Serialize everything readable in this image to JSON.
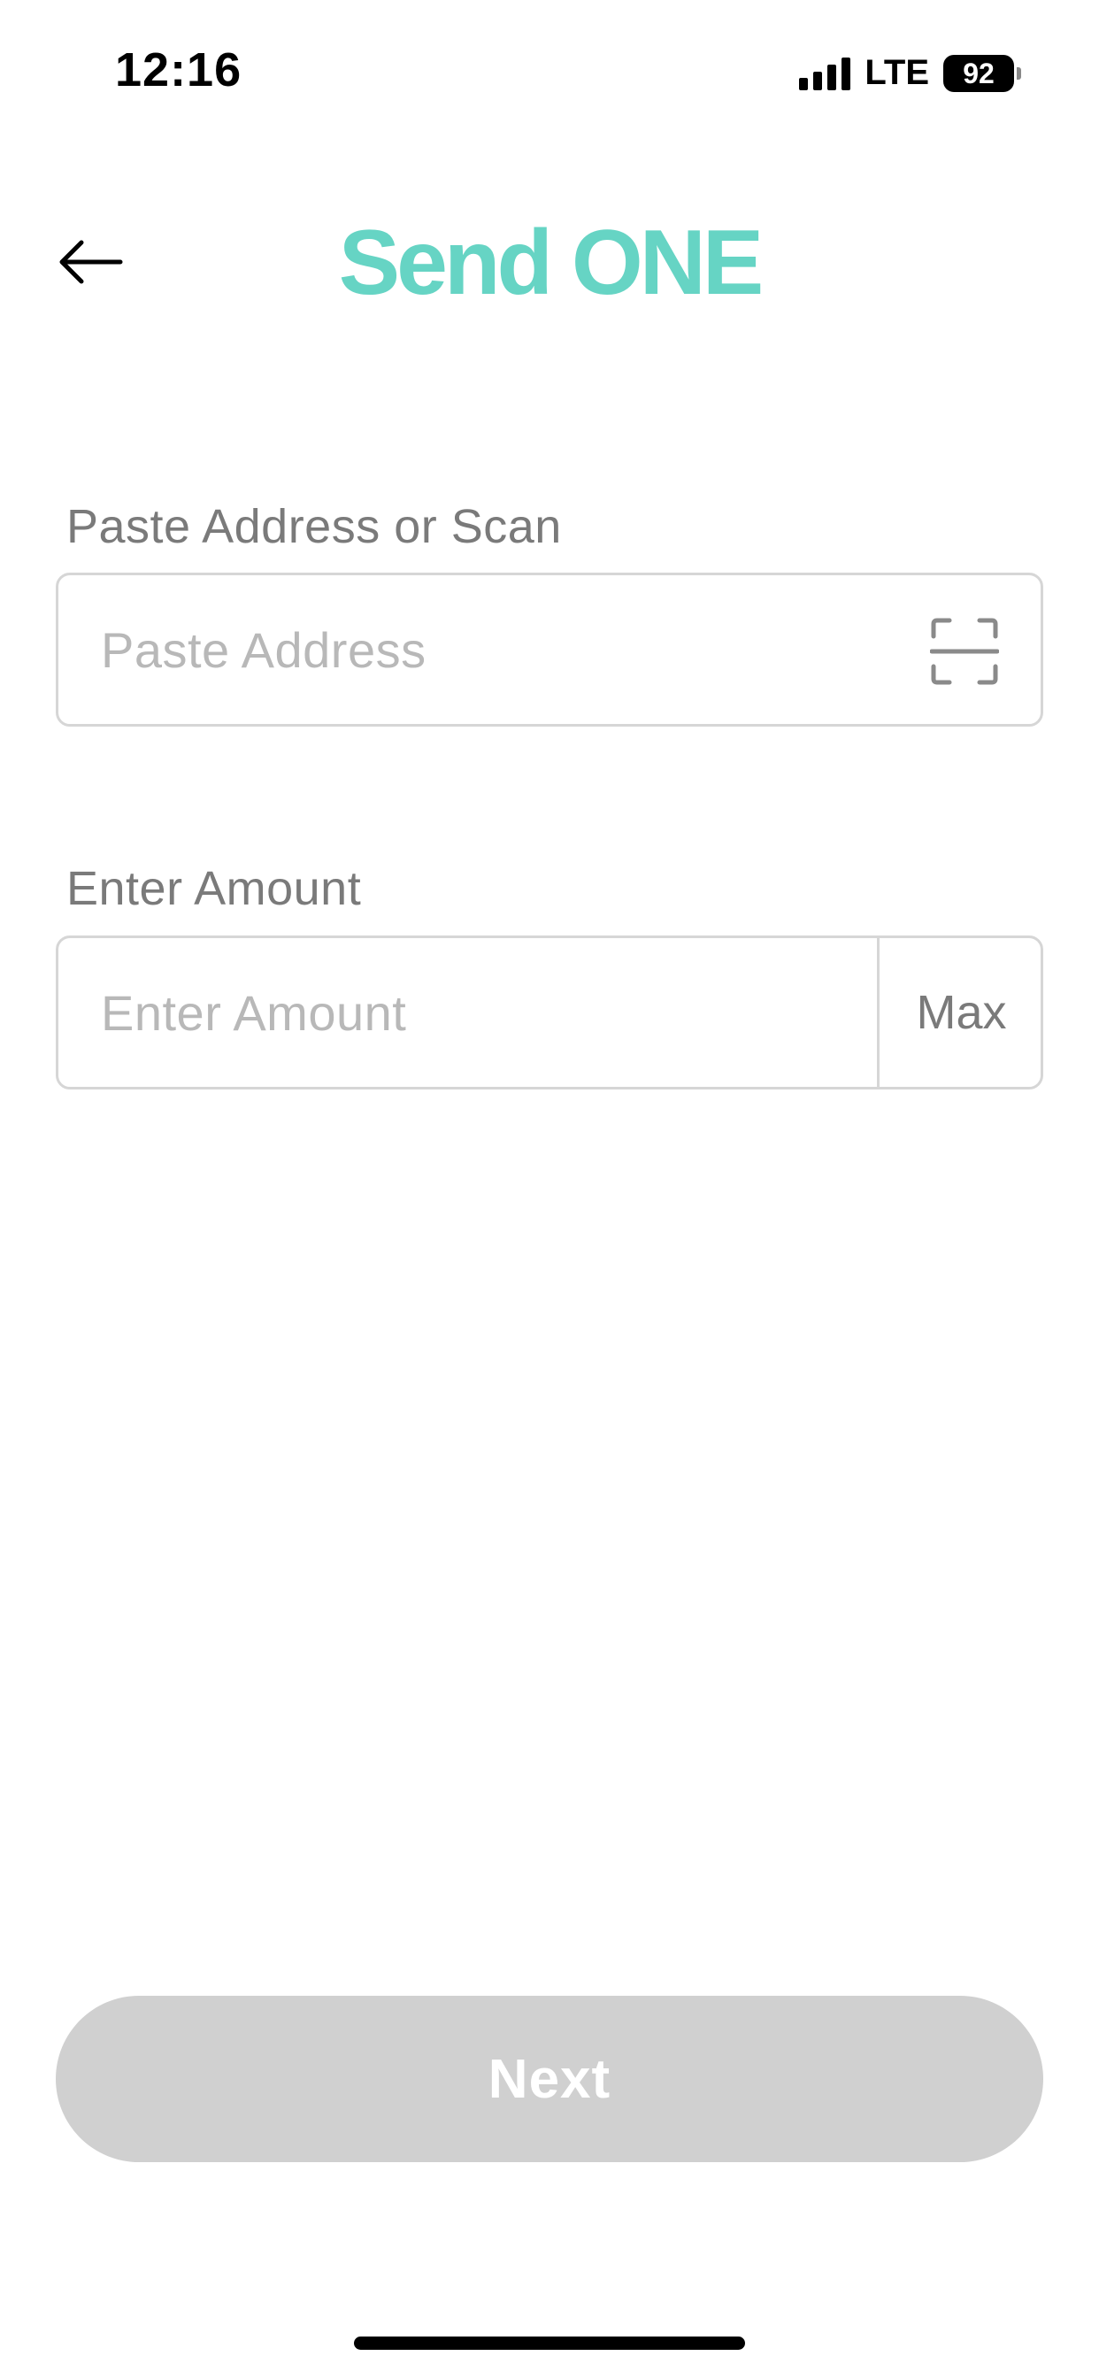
{
  "status_bar": {
    "time": "12:16",
    "network": "LTE",
    "battery": "92"
  },
  "header": {
    "title": "Send ONE",
    "back_icon": "arrow-left-icon"
  },
  "address_field": {
    "label": "Paste Address or Scan",
    "placeholder": "Paste Address",
    "value": "",
    "scan_icon": "scan-qr-icon"
  },
  "amount_field": {
    "label": "Enter Amount",
    "placeholder": "Enter Amount",
    "value": "",
    "max_label": "Max"
  },
  "footer": {
    "next_label": "Next"
  },
  "colors": {
    "title": "#66d4c4",
    "next_disabled_bg": "#d0d0d0",
    "label": "#7a7a7a",
    "placeholder": "#b8b8b8",
    "border": "#d6d6d6"
  }
}
